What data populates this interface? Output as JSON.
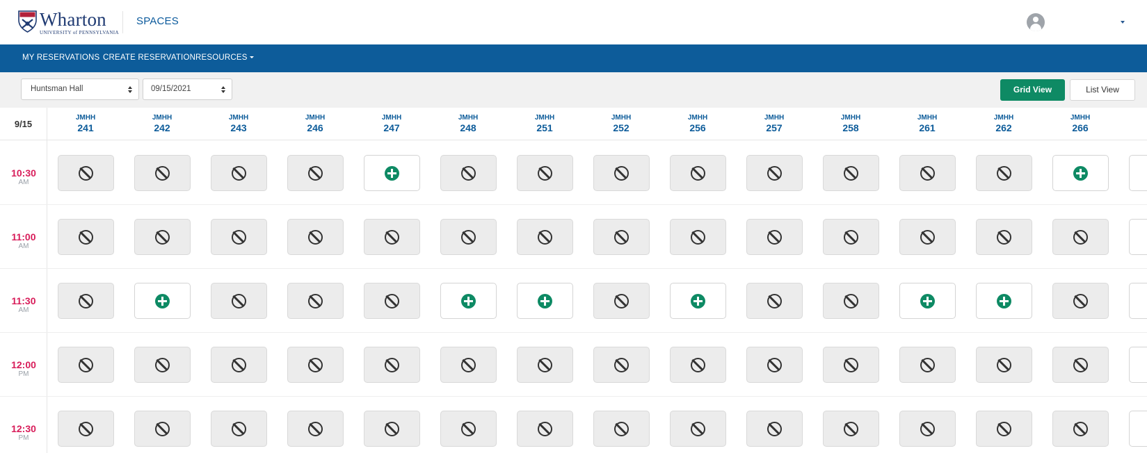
{
  "header": {
    "logo_word": "Wharton",
    "logo_sub": "UNIVERSITY of PENNSYLVANIA",
    "app_title": "SPACES",
    "user_icon": "user-avatar-icon",
    "user_menu_icon": "caret-down-icon"
  },
  "nav": {
    "items": [
      {
        "label": "MY RESERVATIONS"
      },
      {
        "label": "CREATE RESERVATION"
      },
      {
        "label": "RESOURCES",
        "has_dropdown": true
      }
    ]
  },
  "controls": {
    "building": "Huntsman Hall",
    "date": "09/15/2021",
    "grid_view_label": "Grid View",
    "list_view_label": "List View",
    "active_view": "Grid View"
  },
  "grid": {
    "date_label": "9/15",
    "rooms": [
      {
        "building": "JMHH",
        "number": "241"
      },
      {
        "building": "JMHH",
        "number": "242"
      },
      {
        "building": "JMHH",
        "number": "243"
      },
      {
        "building": "JMHH",
        "number": "246"
      },
      {
        "building": "JMHH",
        "number": "247"
      },
      {
        "building": "JMHH",
        "number": "248"
      },
      {
        "building": "JMHH",
        "number": "251"
      },
      {
        "building": "JMHH",
        "number": "252"
      },
      {
        "building": "JMHH",
        "number": "256"
      },
      {
        "building": "JMHH",
        "number": "257"
      },
      {
        "building": "JMHH",
        "number": "258"
      },
      {
        "building": "JMHH",
        "number": "261"
      },
      {
        "building": "JMHH",
        "number": "262"
      },
      {
        "building": "JMHH",
        "number": "266"
      }
    ],
    "times": [
      {
        "time": "10:30",
        "ampm": "AM",
        "availability": [
          false,
          false,
          false,
          false,
          true,
          false,
          false,
          false,
          false,
          false,
          false,
          false,
          false,
          true,
          true
        ]
      },
      {
        "time": "11:00",
        "ampm": "AM",
        "availability": [
          false,
          false,
          false,
          false,
          false,
          false,
          false,
          false,
          false,
          false,
          false,
          false,
          false,
          false,
          true
        ]
      },
      {
        "time": "11:30",
        "ampm": "AM",
        "availability": [
          false,
          true,
          false,
          false,
          false,
          true,
          true,
          false,
          true,
          false,
          false,
          true,
          true,
          false,
          true
        ]
      },
      {
        "time": "12:00",
        "ampm": "PM",
        "availability": [
          false,
          false,
          false,
          false,
          false,
          false,
          false,
          false,
          false,
          false,
          false,
          false,
          false,
          false,
          true
        ]
      },
      {
        "time": "12:30",
        "ampm": "PM",
        "availability": [
          false,
          false,
          false,
          false,
          false,
          false,
          false,
          false,
          false,
          false,
          false,
          false,
          false,
          false,
          true
        ]
      }
    ],
    "slot_icons": {
      "available": "plus-circle-icon",
      "unavailable": "ban-icon"
    },
    "colors": {
      "accent": "#0d5c9a",
      "available": "#0e8a64",
      "time": "#d81d5a"
    }
  }
}
